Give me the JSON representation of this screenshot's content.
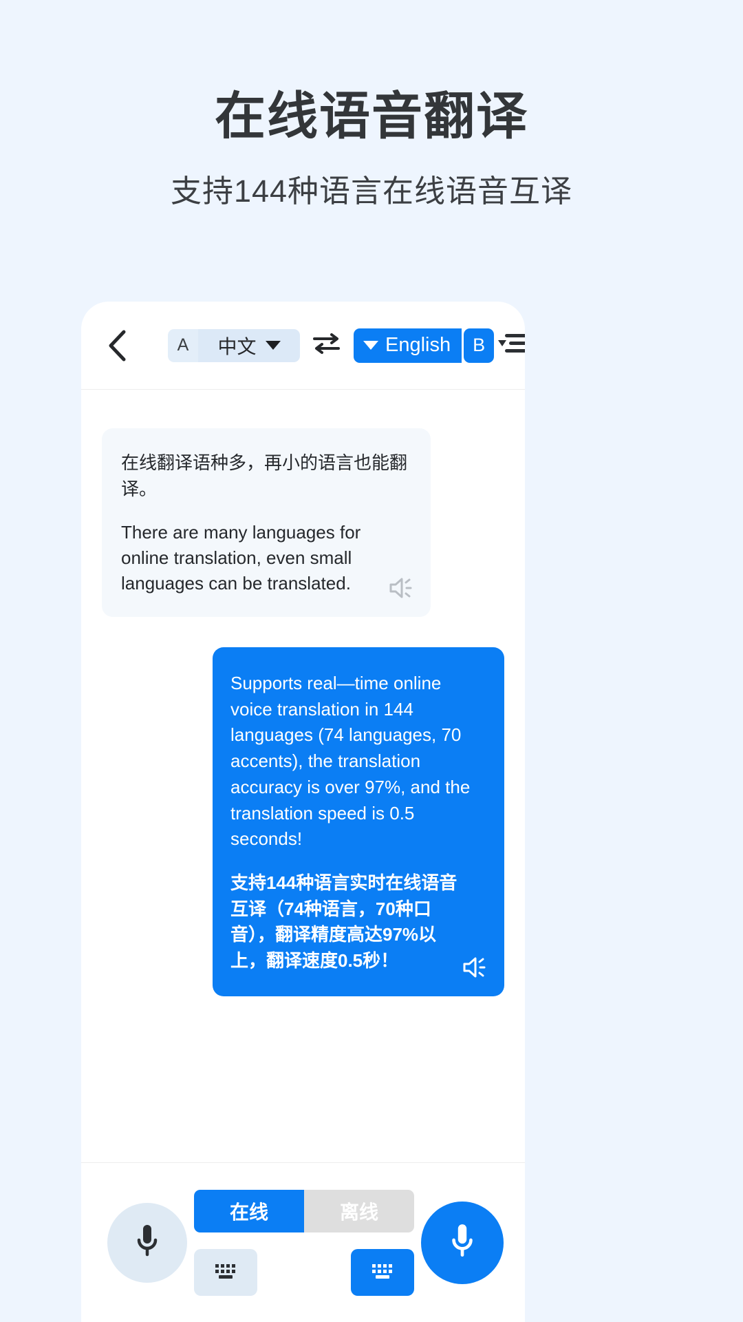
{
  "promo": {
    "title": "在线语音翻译",
    "subtitle": "支持144种语言在线语音互译"
  },
  "app_header": {
    "back_icon": "chevron-left-icon",
    "source_badge": "A",
    "source_language": "中文",
    "swap_icon": "swap-arrows-icon",
    "target_language": "English",
    "target_badge": "B",
    "menu_icon": "list-menu-icon"
  },
  "conversation": {
    "messages": [
      {
        "side": "incoming",
        "source_text": "在线翻译语种多，再小的语言也能翻译。",
        "translated_text": "There are many languages for online translation, even small languages can be translated.",
        "speaker_icon": "speaker-icon"
      },
      {
        "side": "outgoing",
        "source_text": "Supports real—time online voice translation in 144 languages (74 languages, 70 accents), the translation accuracy is over 97%, and the translation speed is 0.5 seconds!",
        "translated_text": "支持144种语言实时在线语音互译（74种语言，70种口音），翻译精度高达97%以上，翻译速度0.5秒！",
        "speaker_icon": "speaker-icon"
      }
    ]
  },
  "bottom_bar": {
    "mic_left_icon": "microphone-icon",
    "mic_right_icon": "microphone-icon",
    "mode_online": "在线",
    "mode_offline": "离线",
    "keyboard_left_icon": "keyboard-icon",
    "keyboard_right_icon": "keyboard-icon"
  },
  "colors": {
    "page_bg": "#eef5fe",
    "accent_blue": "#0b7ef4",
    "bubble_in_bg": "#f4f8fc",
    "pill_light_bg": "#dce9f7",
    "toggle_off_bg": "#dedede",
    "title_text": "#333639"
  }
}
